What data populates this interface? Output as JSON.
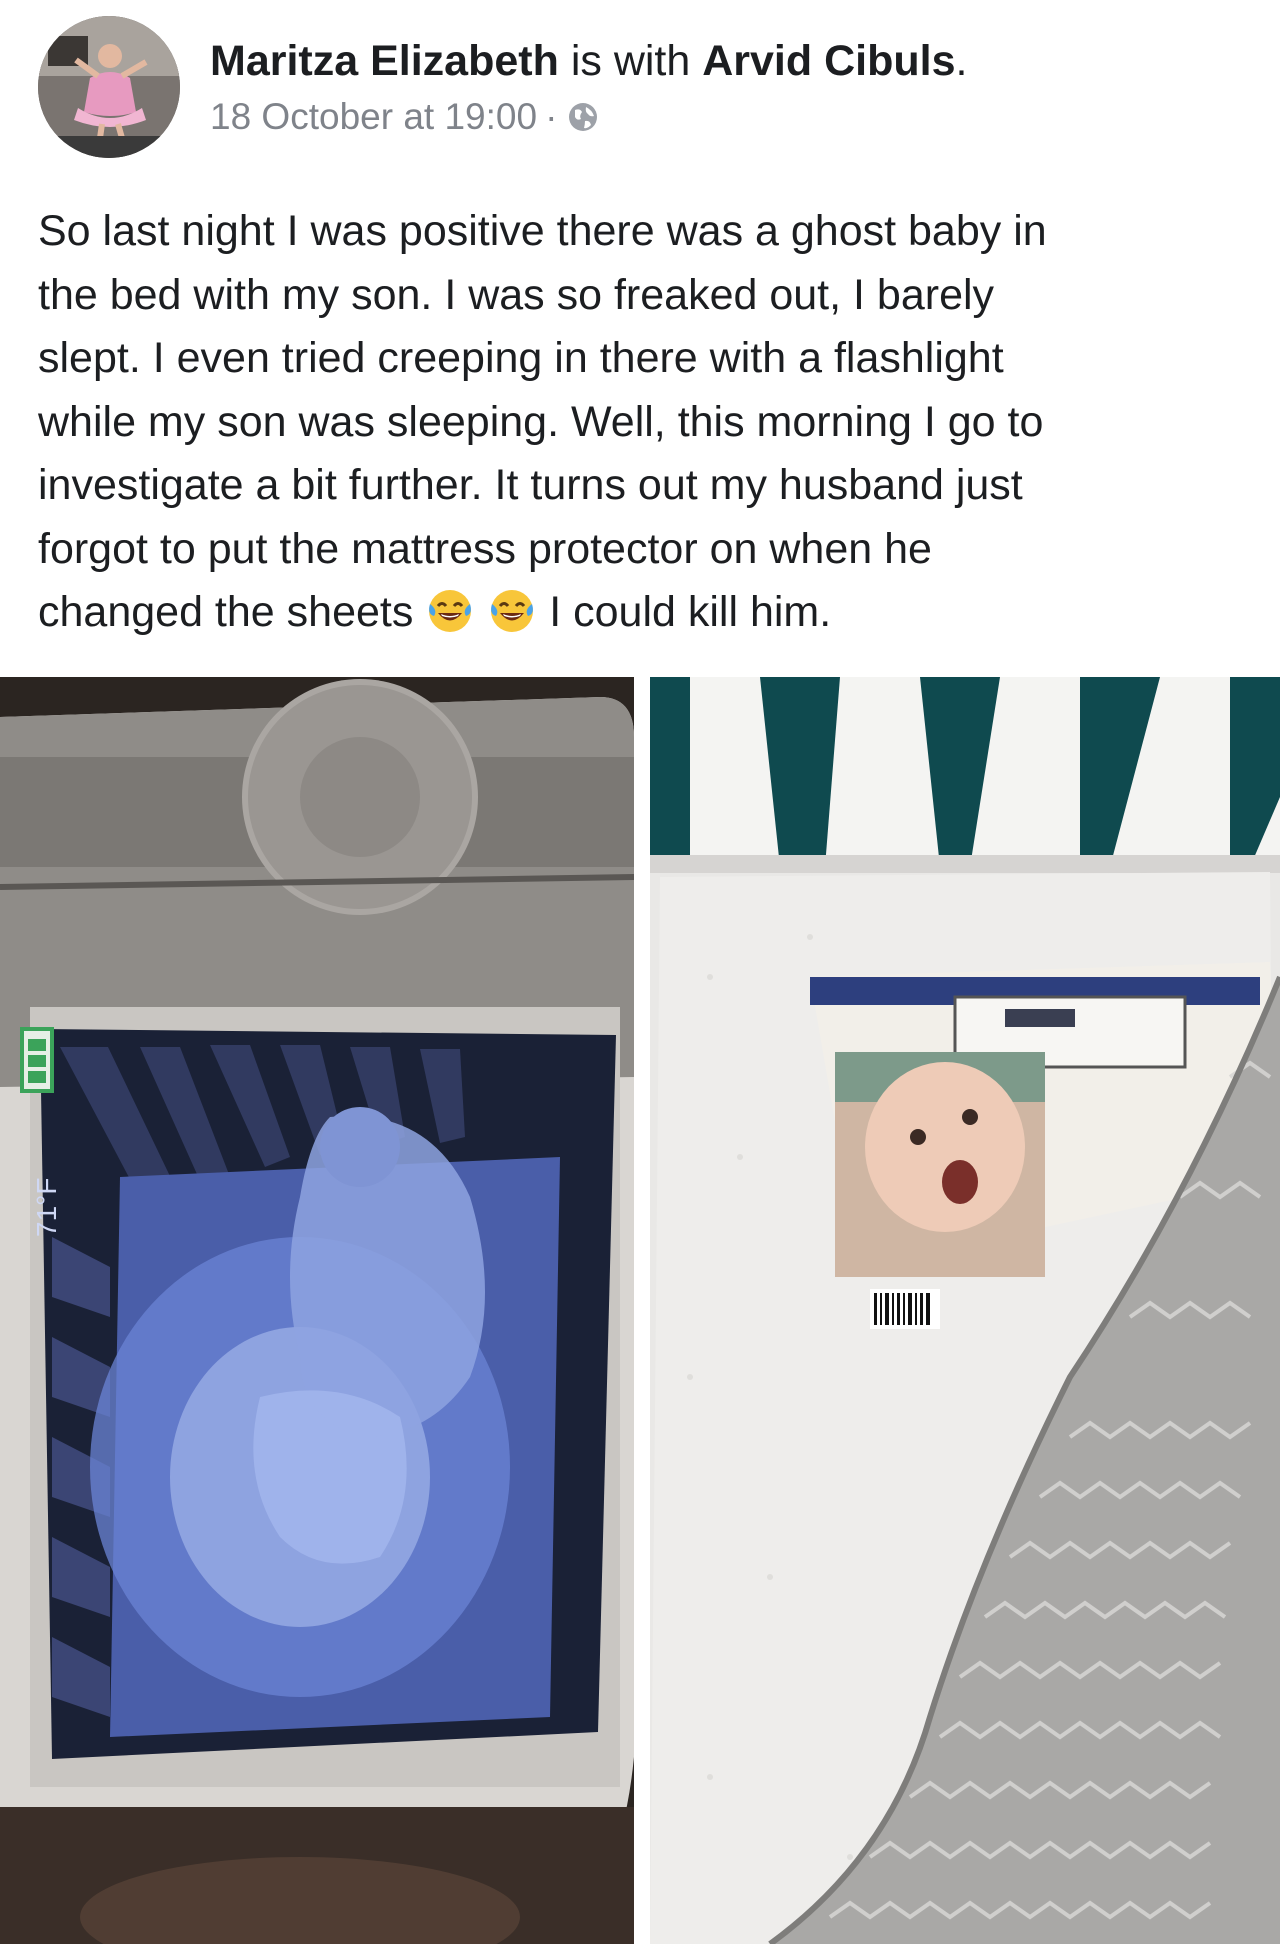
{
  "post": {
    "author": "Maritza Elizabeth",
    "with_text": "is with",
    "tagged": "Arvid Cibuls",
    "period": ".",
    "timestamp": "18 October at 19:00",
    "separator": "·",
    "privacy_icon": "globe-icon",
    "text_lines": [
      "So last night I was positive there was a ghost baby in",
      "the bed with my son. I was so freaked out, I barely",
      "slept. I even tried creeping in there with a flashlight",
      "while my son was sleeping. Well, this morning I go to",
      "investigate a bit further. It turns out my husband just",
      "forgot to put the mattress protector on when he"
    ],
    "last_line_start": "changed the sheets",
    "last_line_end": "I could kill him.",
    "emoji": "tears-of-joy-emoji"
  },
  "monitor": {
    "temperature": "71°F"
  },
  "colors": {
    "text": "#1c1e21",
    "meta": "#7f838a",
    "monitor_screen": "#5a72c8",
    "crib_stripe": "#0f4a4f"
  }
}
